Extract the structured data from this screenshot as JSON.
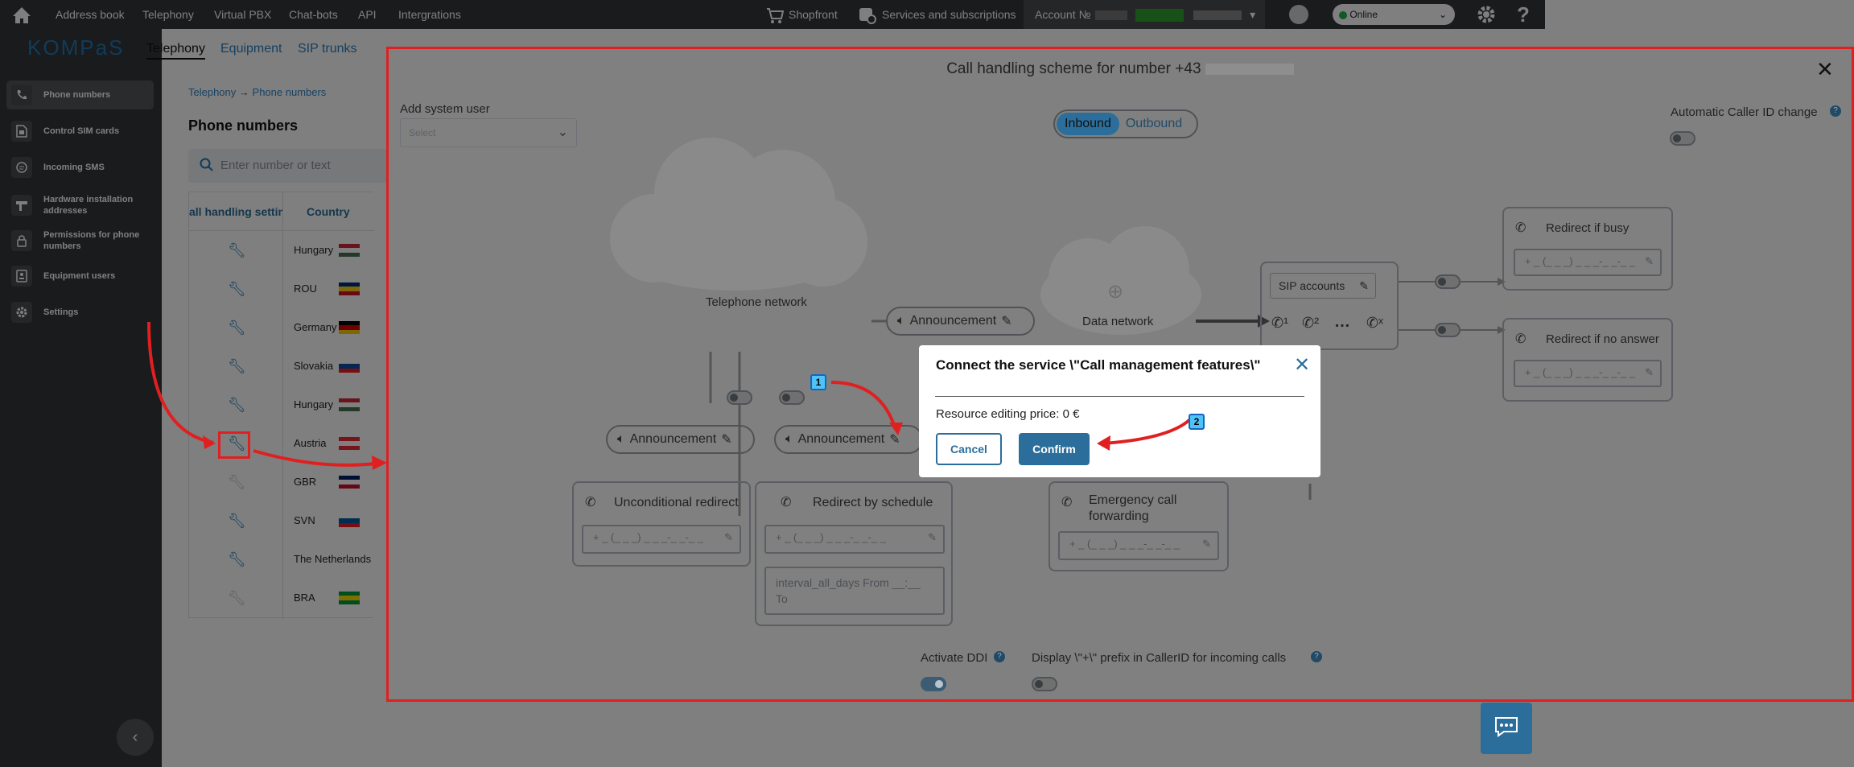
{
  "topbar": {
    "nav": [
      "Address book",
      "Telephony",
      "Virtual PBX",
      "Chat-bots",
      "API",
      "Intergrations"
    ],
    "shopfront": "Shopfront",
    "services": "Services and subscriptions",
    "account_label": "Account №",
    "status": "Online"
  },
  "brand": {
    "logo": "KOMPaS"
  },
  "subnav": [
    "Telephony",
    "Equipment",
    "SIP trunks"
  ],
  "sidebar": {
    "items": [
      {
        "label": "Phone numbers",
        "icon": "phone-icon"
      },
      {
        "label": "Control SIM cards",
        "icon": "sim-card-icon"
      },
      {
        "label": "Incoming SMS",
        "icon": "sms-icon"
      },
      {
        "label": "Hardware installation addresses",
        "icon": "hardware-icon"
      },
      {
        "label": "Permissions for phone numbers",
        "icon": "lock-icon"
      },
      {
        "label": "Equipment users",
        "icon": "user-icon"
      },
      {
        "label": "Settings",
        "icon": "gear-icon"
      }
    ]
  },
  "breadcrumb": {
    "root": "Telephony",
    "current": "Phone numbers"
  },
  "page": {
    "title": "Phone numbers",
    "search_placeholder": "Enter number or text"
  },
  "table": {
    "headers": [
      "all handling setting",
      "Country"
    ],
    "rows": [
      {
        "country": "Hungary",
        "active": true
      },
      {
        "country": "ROU",
        "active": true
      },
      {
        "country": "Germany",
        "active": true
      },
      {
        "country": "Slovakia",
        "active": true
      },
      {
        "country": "Hungary",
        "active": true
      },
      {
        "country": "Austria",
        "active": true
      },
      {
        "country": "GBR",
        "active": false
      },
      {
        "country": "SVN",
        "active": true
      },
      {
        "country": "The Netherlands",
        "active": true
      },
      {
        "country": "BRA",
        "active": false
      }
    ]
  },
  "panel": {
    "title": "Call handling scheme for number +43",
    "add_user_label": "Add system user",
    "select_placeholder": "Select",
    "tab_inbound": "Inbound",
    "tab_outbound": "Outbound",
    "auto_cid": "Automatic Caller ID change",
    "telephone_network": "Telephone network",
    "data_network": "Data network",
    "announcement": "Announcement",
    "sip_accounts": "SIP accounts",
    "sip_icons": [
      "1",
      "2",
      "…",
      "x"
    ],
    "redirect_busy": "Redirect if busy",
    "redirect_no_answer": "Redirect if no answer",
    "unconditional_redirect": "Unconditional redirect",
    "redirect_schedule": "Redirect by schedule",
    "emergency_forwarding": "Emergency call forwarding",
    "phone_placeholder": "+ _ (_ _ _) _ _ _-_ _-_ _",
    "schedule_text": "interval_all_days From __:__ To",
    "activate_ddi": "Activate DDI",
    "display_prefix": "Display \\\"+\\\" prefix in CallerID for incoming calls"
  },
  "dialog": {
    "title": "Connect the service \\\"Call management features\\\"",
    "price": "Resource editing price: 0 €",
    "cancel": "Cancel",
    "confirm": "Confirm"
  },
  "annotations": {
    "badge1": "1",
    "badge2": "2"
  },
  "colors": {
    "accent": "#2c6e9b",
    "danger": "#e02020",
    "topbar": "#343639"
  }
}
